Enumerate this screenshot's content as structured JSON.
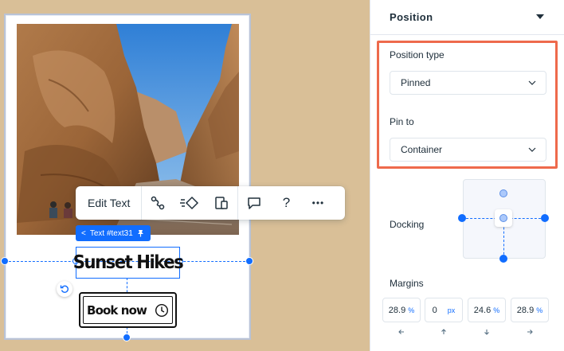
{
  "canvas": {
    "toolbar": {
      "edit_text_label": "Edit Text",
      "buttons": [
        "link-icon",
        "animation-icon",
        "layout-icon",
        "comment-icon",
        "help-icon",
        "more-icon"
      ],
      "help_glyph": "?",
      "more_glyph": "•••"
    },
    "element_chip": {
      "back_glyph": "<",
      "label": "Text #text31",
      "pin_icon": "pin-icon"
    },
    "title_text": "Sunset Hikes",
    "cta_button": {
      "label": "Book now",
      "icon": "clock-icon"
    }
  },
  "panel": {
    "title": "Position",
    "position_type": {
      "label": "Position type",
      "value": "Pinned"
    },
    "pin_to": {
      "label": "Pin to",
      "value": "Container"
    },
    "docking": {
      "label": "Docking"
    },
    "margins": {
      "label": "Margins",
      "fields": [
        {
          "value": "28.9",
          "unit": "%",
          "arrow": "left-arrow-icon"
        },
        {
          "value": "0",
          "unit": "px",
          "arrow": "up-arrow-icon"
        },
        {
          "value": "24.6",
          "unit": "%",
          "arrow": "down-arrow-icon"
        },
        {
          "value": "28.9",
          "unit": "%",
          "arrow": "right-arrow-icon"
        }
      ]
    }
  },
  "colors": {
    "accent": "#116dff",
    "highlight": "#ee6a4c",
    "canvas_bg": "#d9bf97"
  }
}
